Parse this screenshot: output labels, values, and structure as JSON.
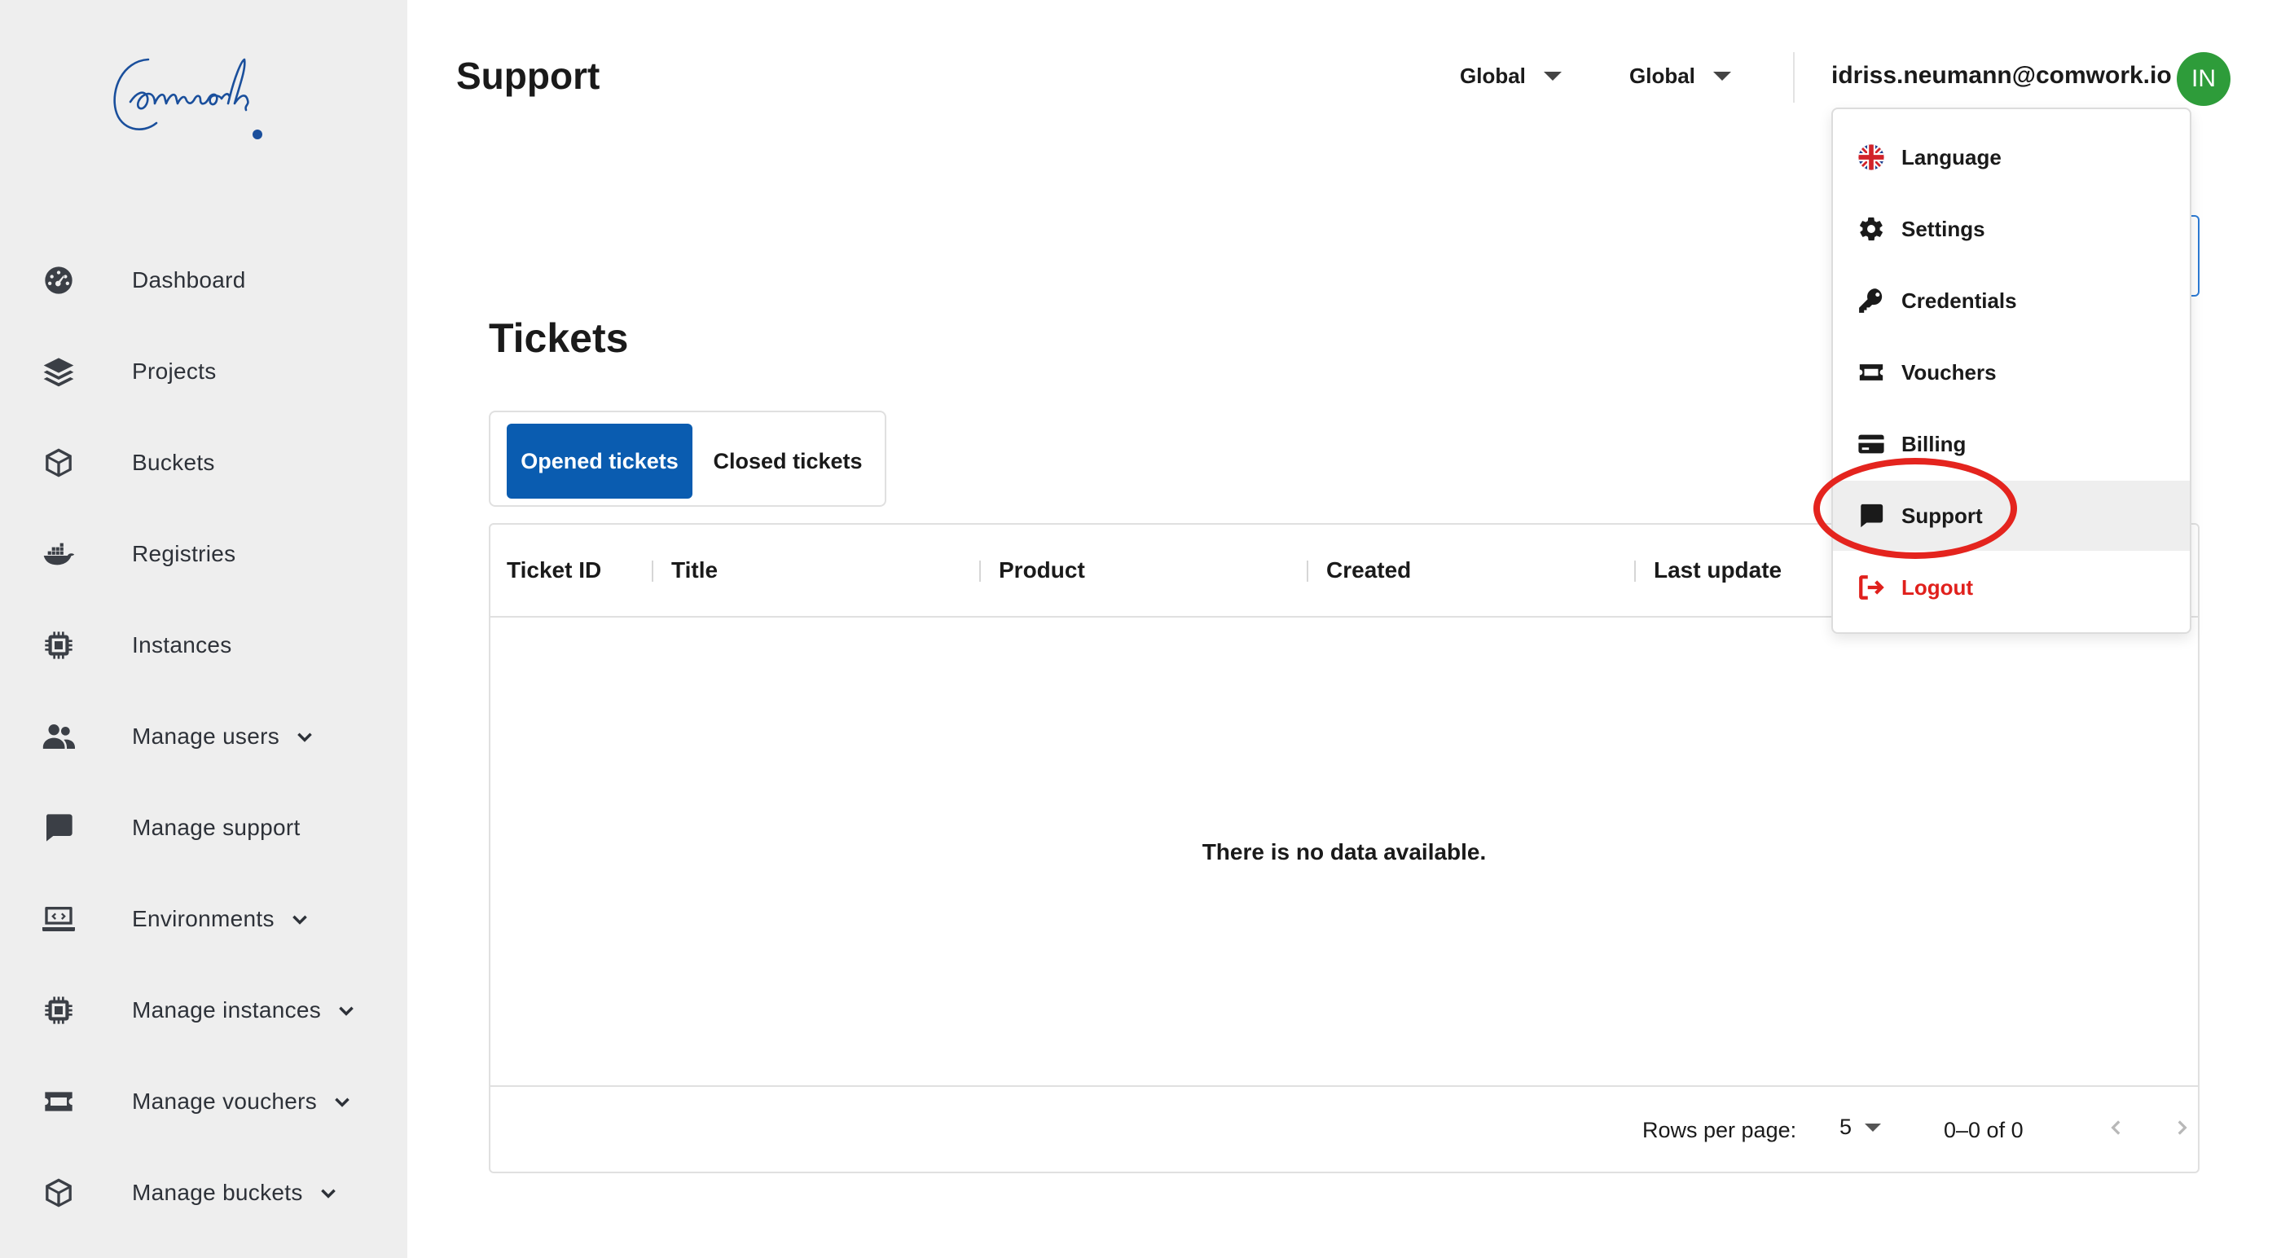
{
  "app": {
    "logo_text": "Comwork",
    "page_title": "Support"
  },
  "sidebar": {
    "items": [
      {
        "label": "Dashboard",
        "icon": "dashboard-icon",
        "has_submenu": false
      },
      {
        "label": "Projects",
        "icon": "layers-icon",
        "has_submenu": false
      },
      {
        "label": "Buckets",
        "icon": "cube-icon",
        "has_submenu": false
      },
      {
        "label": "Registries",
        "icon": "docker-icon",
        "has_submenu": false
      },
      {
        "label": "Instances",
        "icon": "chip-icon",
        "has_submenu": false
      },
      {
        "label": "Manage users",
        "icon": "users-icon",
        "has_submenu": true
      },
      {
        "label": "Manage support",
        "icon": "chat-icon",
        "has_submenu": false
      },
      {
        "label": "Environments",
        "icon": "laptop-code-icon",
        "has_submenu": true
      },
      {
        "label": "Manage instances",
        "icon": "chip-icon",
        "has_submenu": true
      },
      {
        "label": "Manage vouchers",
        "icon": "ticket-icon",
        "has_submenu": true
      },
      {
        "label": "Manage buckets",
        "icon": "cube-icon",
        "has_submenu": true
      }
    ]
  },
  "header": {
    "region_selectors": [
      "Global",
      "Global"
    ],
    "user_email": "idriss.neumann@comwork.io",
    "avatar_initials": "IN",
    "avatar_color": "#2e9c3a"
  },
  "tickets": {
    "title": "Tickets",
    "tabs": [
      {
        "label": "Opened tickets",
        "active": true
      },
      {
        "label": "Closed tickets",
        "active": false
      }
    ],
    "columns": [
      "Ticket ID",
      "Title",
      "Product",
      "Created",
      "Last update"
    ],
    "empty_message": "There is no data available.",
    "pagination": {
      "rows_per_page_label": "Rows per page:",
      "rows_per_page_value": "5",
      "range_text": "0–0 of 0"
    }
  },
  "user_menu": {
    "items": [
      {
        "label": "Language",
        "icon": "uk-flag-icon"
      },
      {
        "label": "Settings",
        "icon": "gear-icon"
      },
      {
        "label": "Credentials",
        "icon": "key-icon"
      },
      {
        "label": "Vouchers",
        "icon": "ticket-icon"
      },
      {
        "label": "Billing",
        "icon": "credit-card-icon"
      },
      {
        "label": "Support",
        "icon": "chat-icon",
        "highlighted": true
      },
      {
        "label": "Logout",
        "icon": "logout-icon",
        "color": "#e0201c"
      }
    ]
  },
  "colors": {
    "primary": "#0a5cb0",
    "highlight_ring": "#e4241e",
    "sidebar_bg": "#eeeeee"
  }
}
